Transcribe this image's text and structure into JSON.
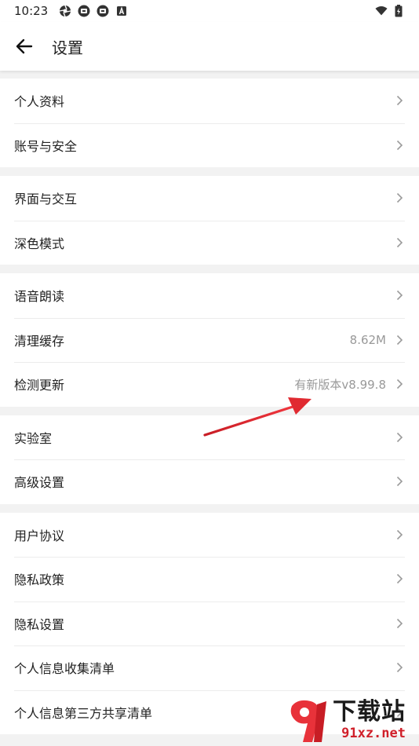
{
  "status_bar": {
    "time": "10:23",
    "icons": [
      "aperture-icon",
      "app-badge-icon",
      "app-badge-icon",
      "letter-a-icon"
    ],
    "right_icons": [
      "wifi-icon",
      "battery-icon"
    ]
  },
  "header": {
    "title": "设置",
    "back_icon": "arrow-left-icon"
  },
  "groups": [
    {
      "items": [
        {
          "label": "个人资料"
        },
        {
          "label": "账号与安全"
        }
      ]
    },
    {
      "items": [
        {
          "label": "界面与交互"
        },
        {
          "label": "深色模式"
        }
      ]
    },
    {
      "items": [
        {
          "label": "语音朗读"
        },
        {
          "label": "清理缓存",
          "value": "8.62M"
        },
        {
          "label": "检测更新",
          "value": "有新版本v8.99.8"
        }
      ]
    },
    {
      "items": [
        {
          "label": "实验室"
        },
        {
          "label": "高级设置"
        }
      ]
    },
    {
      "items": [
        {
          "label": "用户协议"
        },
        {
          "label": "隐私政策"
        },
        {
          "label": "隐私设置"
        },
        {
          "label": "个人信息收集清单"
        },
        {
          "label": "个人信息第三方共享清单"
        }
      ]
    }
  ],
  "watermark": {
    "title": "下载站",
    "url": "91xz.net"
  },
  "colors": {
    "background": "#f2f2f2",
    "surface": "#ffffff",
    "text": "#222222",
    "secondary_text": "#999999",
    "annotation_arrow": "#d9232a"
  }
}
